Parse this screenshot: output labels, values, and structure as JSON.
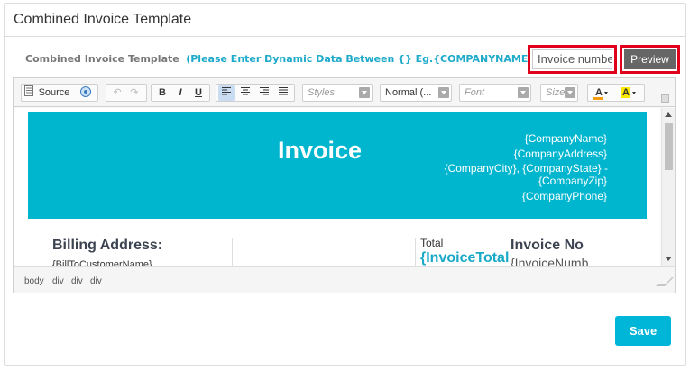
{
  "panel": {
    "title": "Combined Invoice Template"
  },
  "form": {
    "label": "Combined Invoice Template",
    "hint": "(Please Enter Dynamic Data Between {} Eg.{COMPANYNAME})",
    "invoice_number_value": "Invoice number",
    "preview_label": "Preview",
    "save_label": "Save"
  },
  "toolbar": {
    "source_label": "Source",
    "bold": "B",
    "italic": "I",
    "underline": "U",
    "styles_placeholder": "Styles",
    "format_value": "Normal (...",
    "font_placeholder": "Font",
    "size_placeholder": "Size"
  },
  "template": {
    "heading": "Invoice",
    "company_name": "{CompanyName}",
    "company_address": "{CompanyAddress}",
    "company_city_state": "{CompanyCity}, {CompanyState} -",
    "company_zip": "{CompanyZip}",
    "company_phone": "{CompanyPhone}",
    "billing_label": "Billing Address:",
    "billing_value": "{BillToCustomerName}",
    "total_label": "Total",
    "total_value": "{InvoiceTotal",
    "invoice_no_label": "Invoice No",
    "invoice_no_value": "{InvoiceNumb"
  },
  "statusbar": {
    "path": [
      "body",
      "div",
      "div",
      "div"
    ]
  },
  "colors": {
    "accent": "#00b6cf",
    "save": "#00b6d8",
    "preview": "#666666",
    "highlight": "#e0001b"
  }
}
